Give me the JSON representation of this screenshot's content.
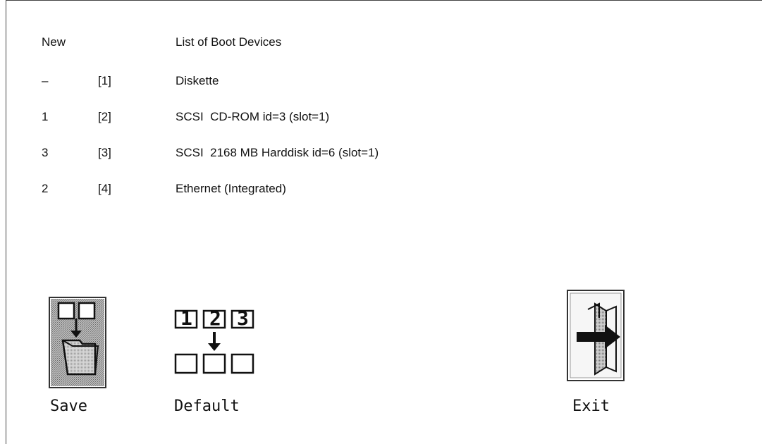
{
  "header": {
    "new_label": "New",
    "list_label": "List of Boot Devices"
  },
  "devices": [
    {
      "new": "–",
      "slot": "[1]",
      "name": "Diskette"
    },
    {
      "new": "1",
      "slot": "[2]",
      "name": "SCSI  CD-ROM id=3 (slot=1)"
    },
    {
      "new": "3",
      "slot": "[3]",
      "name": "SCSI  2168 MB Harddisk id=6 (slot=1)"
    },
    {
      "new": "2",
      "slot": "[4]",
      "name": "Ethernet (Integrated)"
    }
  ],
  "buttons": {
    "save": {
      "label": "Save",
      "icon": "save-folder-icon"
    },
    "default": {
      "label": "Default",
      "icon": "default-order-icon"
    },
    "exit": {
      "label": "Exit",
      "icon": "exit-door-icon"
    }
  },
  "default_icon_digits": [
    "1",
    "2",
    "3"
  ]
}
